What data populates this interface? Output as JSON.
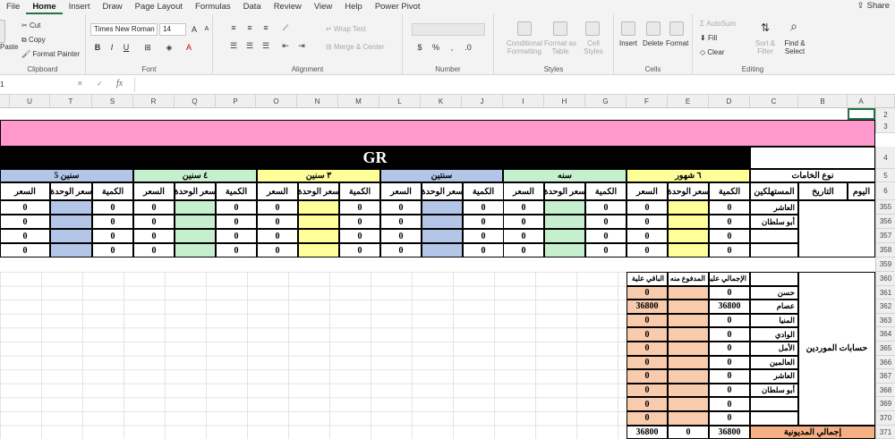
{
  "tabs": [
    "File",
    "Home",
    "Insert",
    "Draw",
    "Page Layout",
    "Formulas",
    "Data",
    "Review",
    "View",
    "Help",
    "Power Pivot"
  ],
  "share": "Share",
  "ribbon": {
    "clipboard": {
      "paste": "Paste",
      "cut": "Cut",
      "copy": "Copy",
      "format_painter": "Format Painter",
      "label": "Clipboard"
    },
    "font": {
      "name": "Times New Roman",
      "size": "14",
      "bold": "B",
      "italic": "I",
      "underline": "U",
      "grow": "A",
      "shrink": "A",
      "color": "A",
      "label": "Font"
    },
    "alignment": {
      "wrap": "Wrap Text",
      "merge": "Merge & Center",
      "label": "Alignment"
    },
    "number": {
      "label": "Number"
    },
    "styles": {
      "conditional": "Conditional Formatting",
      "format_table": "Format as Table",
      "cell_styles": "Cell Styles",
      "label": "Styles"
    },
    "cells": {
      "insert": "Insert",
      "delete": "Delete",
      "format": "Format",
      "label": "Cells"
    },
    "editing": {
      "autosum": "AutoSum",
      "fill": "Fill",
      "clear": "Clear",
      "sort": "Sort & Filter",
      "find": "Find & Select",
      "label": "Editing"
    }
  },
  "formula_bar": {
    "name_box": "1",
    "fx": "fx",
    "cancel": "✕",
    "enter": "✓",
    "content": ""
  },
  "columns": [
    "U",
    "T",
    "S",
    "R",
    "Q",
    "P",
    "O",
    "N",
    "M",
    "L",
    "K",
    "J",
    "I",
    "H",
    "G",
    "F",
    "E",
    "D",
    "C",
    "B",
    "A"
  ],
  "rows": [
    "1",
    "2",
    "3",
    "4",
    "5",
    "6",
    "355",
    "356",
    "357",
    "358",
    "359",
    "360",
    "361",
    "362",
    "363",
    "364",
    "365",
    "366",
    "367",
    "368",
    "369",
    "370",
    "371"
  ],
  "sheet": {
    "title": "GR",
    "material_type": "نوع الخامات",
    "periods": [
      "سنين 5",
      "٤ سنين",
      "٣ سنين",
      "سنتين",
      "سنه",
      "٦ شهور"
    ],
    "sub_headers": [
      "الكمية",
      "سعر الوحدة",
      "السعر"
    ],
    "day": "اليوم",
    "date": "التاريخ",
    "consumers": "المستهلكين",
    "consumer_names": [
      "العاشر",
      "أبو سلطان",
      "",
      ""
    ],
    "zero": "0",
    "suppliers_title": "حسابات الموردين",
    "supplier_headers": {
      "total": "الإجمالي علية",
      "paid": "المدفوع منه",
      "remaining": "الباقي علية"
    },
    "suppliers": [
      {
        "name": "حسن",
        "total": "0",
        "remaining": "0"
      },
      {
        "name": "عصام",
        "total": "36800",
        "remaining": "36800"
      },
      {
        "name": "المنيا",
        "total": "0",
        "remaining": "0"
      },
      {
        "name": "الوادي",
        "total": "0",
        "remaining": "0"
      },
      {
        "name": "الأمل",
        "total": "0",
        "remaining": "0"
      },
      {
        "name": "العالمين",
        "total": "0",
        "remaining": "0"
      },
      {
        "name": "العاشر",
        "total": "0",
        "remaining": "0"
      },
      {
        "name": "أبو سلطان",
        "total": "0",
        "remaining": "0"
      },
      {
        "name": "",
        "total": "0",
        "remaining": "0"
      },
      {
        "name": "",
        "total": "0",
        "remaining": "0"
      }
    ],
    "debt_total_label": "إجمالي المديونية",
    "debt_totals": {
      "total": "36800",
      "paid": "0",
      "remaining": "36800"
    }
  },
  "colors": {
    "pink": "#ff99cc",
    "black": "#000000",
    "blue": "#b4c6e7",
    "green": "#c6efce",
    "yellow": "#ffff99",
    "orange": "#f4b084",
    "peach": "#f8cbad",
    "accent": "#217346"
  }
}
